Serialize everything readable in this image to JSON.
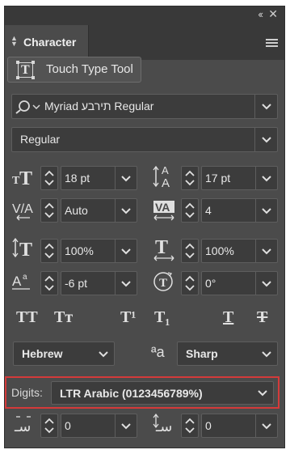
{
  "panel": {
    "title": "Character",
    "collapse_glyph": "‹‹",
    "close_glyph": "✕",
    "menu_icon": "hamburger-menu-icon"
  },
  "touch_type_tool": {
    "label": "Touch Type Tool",
    "icon": "touch-type-icon"
  },
  "font_family": {
    "value": "Myriad תירבע Regular",
    "icon": "font-search-icon"
  },
  "font_style": {
    "value": "Regular"
  },
  "font_size": {
    "value": "18 pt",
    "icon": "font-size-icon"
  },
  "leading": {
    "value": "17 pt",
    "icon": "leading-icon"
  },
  "kerning": {
    "value": "Auto",
    "icon": "kerning-icon"
  },
  "tracking": {
    "value": "4",
    "icon": "tracking-icon"
  },
  "vertical_scale": {
    "value": "100%",
    "icon": "vertical-scale-icon"
  },
  "horizontal_scale": {
    "value": "100%",
    "icon": "horizontal-scale-icon"
  },
  "baseline_shift": {
    "value": "-6 pt",
    "icon": "baseline-shift-icon"
  },
  "rotation": {
    "value": "0°",
    "icon": "character-rotation-icon"
  },
  "type_styles": {
    "all_caps": "TT",
    "small_caps": "Tт",
    "superscript": "T¹",
    "subscript": "T₁",
    "underline": "T",
    "strikethrough": "T"
  },
  "language": {
    "value": "Hebrew"
  },
  "antialias": {
    "value": "Sharp",
    "icon": "antialias-icon",
    "glyph": "ªa"
  },
  "digits": {
    "label": "Digits:",
    "value": "LTR Arabic (0123456789%)"
  },
  "kashida_left": {
    "value": "0",
    "icon": "kashida-insert-icon"
  },
  "kashida_right": {
    "value": "0",
    "icon": "kashida-width-icon"
  },
  "colors": {
    "panel": "#4b4b4b",
    "highlight": "#d43a3a",
    "field": "#3c3c3c"
  }
}
